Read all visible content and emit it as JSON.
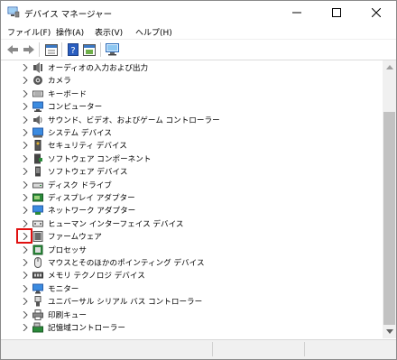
{
  "window": {
    "title": "デバイス マネージャー"
  },
  "menu": [
    "ファイル(F)",
    "操作(A)",
    "表示(V)",
    "ヘルプ(H)"
  ],
  "toolbar": [
    "back-icon",
    "forward-icon",
    "properties-icon",
    "help-icon",
    "properties-alt-icon",
    "monitor-scan-icon"
  ],
  "devices": [
    {
      "label": "オーディオの入力および出力",
      "icon": "audio-icon"
    },
    {
      "label": "カメラ",
      "icon": "camera-icon"
    },
    {
      "label": "キーボード",
      "icon": "keyboard-icon"
    },
    {
      "label": "コンピューター",
      "icon": "computer-icon"
    },
    {
      "label": "サウンド、ビデオ、およびゲーム コントローラー",
      "icon": "speaker-icon"
    },
    {
      "label": "システム デバイス",
      "icon": "system-icon"
    },
    {
      "label": "セキュリティ デバイス",
      "icon": "security-icon"
    },
    {
      "label": "ソフトウェア コンポーネント",
      "icon": "software-component-icon"
    },
    {
      "label": "ソフトウェア デバイス",
      "icon": "software-device-icon"
    },
    {
      "label": "ディスク ドライブ",
      "icon": "disk-icon"
    },
    {
      "label": "ディスプレイ アダプター",
      "icon": "display-adapter-icon"
    },
    {
      "label": "ネットワーク アダプター",
      "icon": "network-icon"
    },
    {
      "label": "ヒューマン インターフェイス デバイス",
      "icon": "hid-icon"
    },
    {
      "label": "ファームウェア",
      "icon": "firmware-icon",
      "highlighted": true
    },
    {
      "label": "プロセッサ",
      "icon": "processor-icon"
    },
    {
      "label": "マウスとそのほかのポインティング デバイス",
      "icon": "mouse-icon"
    },
    {
      "label": "メモリ テクノロジ デバイス",
      "icon": "memory-icon"
    },
    {
      "label": "モニター",
      "icon": "monitor-icon"
    },
    {
      "label": "ユニバーサル シリアル バス コントローラー",
      "icon": "usb-icon"
    },
    {
      "label": "印刷キュー",
      "icon": "printer-icon"
    },
    {
      "label": "記憶域コントローラー",
      "icon": "storage-controller-icon"
    }
  ],
  "colors": {
    "highlight_border": "#e01010",
    "scroll_thumb": "#c2c2c2",
    "accent": "#1e6fc8"
  }
}
